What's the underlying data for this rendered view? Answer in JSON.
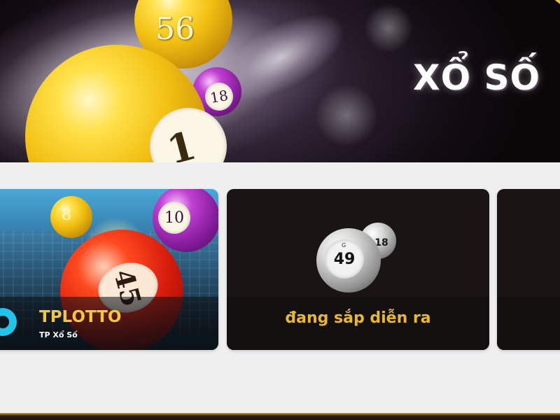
{
  "banner": {
    "title": "XỔ SỐ",
    "balls": {
      "top_number": "56",
      "small_number": "18",
      "big_number": "1"
    }
  },
  "cards": [
    {
      "name": "TPLOTTO",
      "subtitle": "TP Xổ Số",
      "balls": [
        "8",
        "10",
        "45"
      ]
    },
    {
      "status": "đang sắp diễn ra",
      "balls": [
        "49",
        "18"
      ],
      "ball_letter": "G"
    }
  ],
  "colors": {
    "accent_gold": "#f3c640",
    "card_bg": "#1a1414",
    "page_bg": "#efefef"
  }
}
